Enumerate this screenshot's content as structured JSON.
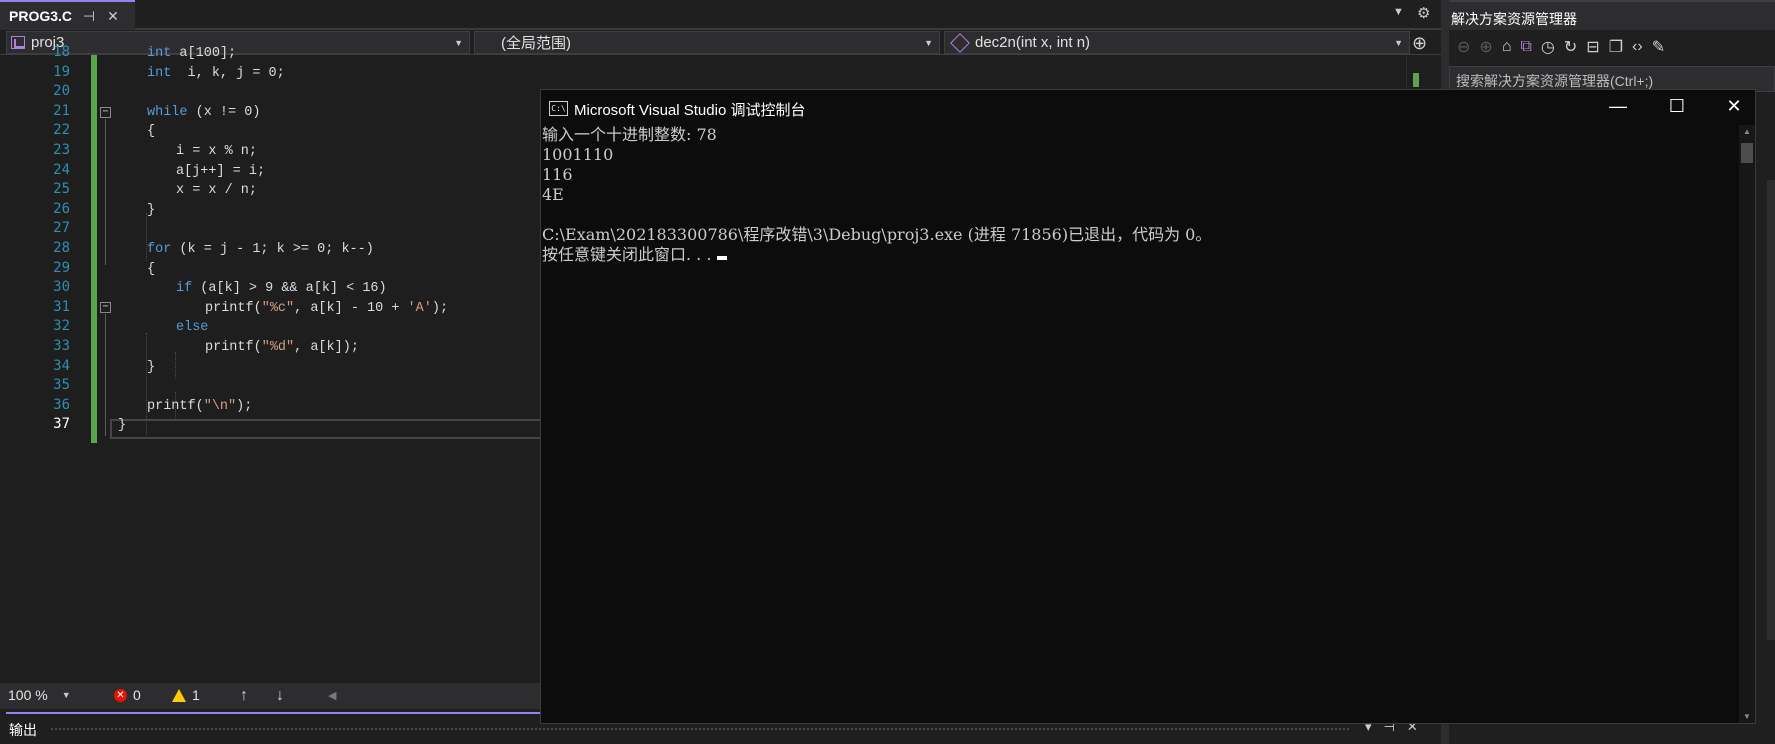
{
  "document_tab": {
    "name": "PROG3.C",
    "pin_icon": "pin-icon",
    "close_icon": "close-icon"
  },
  "navbar": {
    "project": "proj3",
    "scope": "(全局范围)",
    "function": "dec2n(int x, int n)"
  },
  "editor": {
    "lines": [
      {
        "num": "18",
        "code": "int a[100];"
      },
      {
        "num": "19",
        "code": "int  i, k, j = 0;"
      },
      {
        "num": "20",
        "code": ""
      },
      {
        "num": "21",
        "code": "while (x != 0)"
      },
      {
        "num": "22",
        "code": "{"
      },
      {
        "num": "23",
        "code": "i = x % n;"
      },
      {
        "num": "24",
        "code": "a[j++] = i;"
      },
      {
        "num": "25",
        "code": "x = x / n;"
      },
      {
        "num": "26",
        "code": "}"
      },
      {
        "num": "27",
        "code": ""
      },
      {
        "num": "28",
        "code": "for (k = j - 1; k >= 0; k--)"
      },
      {
        "num": "29",
        "code": "{"
      },
      {
        "num": "30",
        "code": "if (a[k] > 9 && a[k] < 16)"
      },
      {
        "num": "31",
        "code": "printf(\"%c\", a[k] - 10 + 'A');"
      },
      {
        "num": "32",
        "code": "else"
      },
      {
        "num": "33",
        "code": "printf(\"%d\", a[k]);"
      },
      {
        "num": "34",
        "code": "}"
      },
      {
        "num": "35",
        "code": ""
      },
      {
        "num": "36",
        "code": "printf(\"\\n\");"
      },
      {
        "num": "37",
        "code": "}"
      }
    ]
  },
  "status": {
    "zoom": "100 %",
    "errors": "0",
    "warnings": "1"
  },
  "output_panel": {
    "title": "输出"
  },
  "solution_explorer": {
    "title": "解决方案资源管理器",
    "search_placeholder": "搜索解决方案资源管理器(Ctrl+;)"
  },
  "console": {
    "title": "Microsoft Visual Studio 调试控制台",
    "icon_text": "C:\\",
    "lines": [
      "输入一个十进制整数: 78",
      "1001110",
      "116",
      "4E",
      "",
      "C:\\Exam\\202183300786\\程序改错\\3\\Debug\\proj3.exe (进程 71856)已退出，代码为 0。",
      "按任意键关闭此窗口. . ."
    ]
  },
  "colors": {
    "accent": "#9184ee",
    "change_bar": "#57a64a",
    "keyword": "#569cd6",
    "string": "#d69d85",
    "line_number": "#2b91af",
    "error": "#e51400",
    "warning": "#ffcc00"
  }
}
